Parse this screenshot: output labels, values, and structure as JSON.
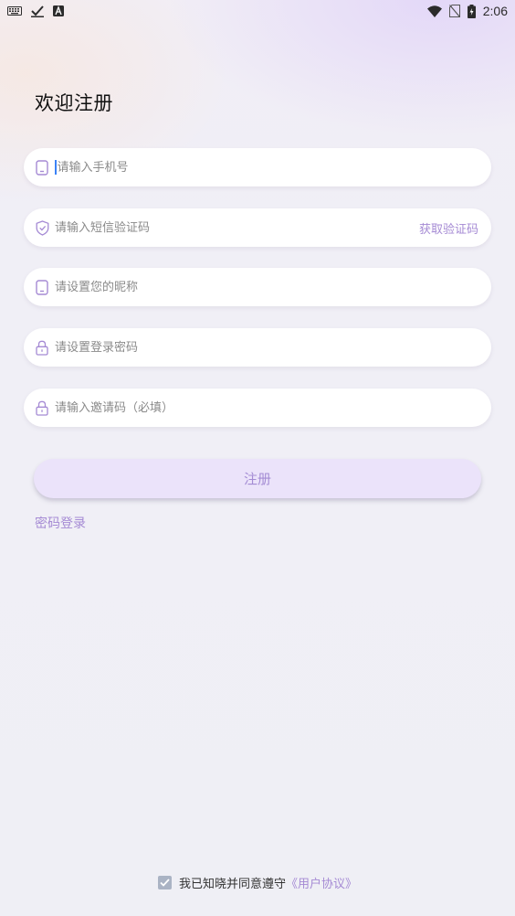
{
  "status_bar": {
    "time": "2:06",
    "icons_left": [
      "keyboard-icon",
      "checkmark-icon",
      "text-a-icon"
    ],
    "icons_right": [
      "wifi-icon",
      "no-sim-icon",
      "battery-icon"
    ]
  },
  "page": {
    "title": "欢迎注册"
  },
  "form": {
    "phone": {
      "placeholder": "请输入手机号",
      "value": "",
      "icon": "phone-icon"
    },
    "sms_code": {
      "placeholder": "请输入短信验证码",
      "value": "",
      "icon": "shield-icon",
      "action_label": "获取验证码"
    },
    "nickname": {
      "placeholder": "请设置您的昵称",
      "value": "",
      "icon": "phone-icon"
    },
    "password": {
      "placeholder": "请设置登录密码",
      "value": "",
      "icon": "lock-icon"
    },
    "invite_code": {
      "placeholder": "请输入邀请码（必填）",
      "value": "",
      "icon": "lock-icon"
    }
  },
  "actions": {
    "register_label": "注册",
    "password_login_label": "密码登录"
  },
  "agreement": {
    "checked": true,
    "text": "我已知晓并同意遵守",
    "link_text": "《用户协议》"
  },
  "colors": {
    "accent": "#a58ad4",
    "button_bg": "#ebe3fa",
    "icon": "#a58ad4",
    "checkbox": "#aab3c4"
  }
}
